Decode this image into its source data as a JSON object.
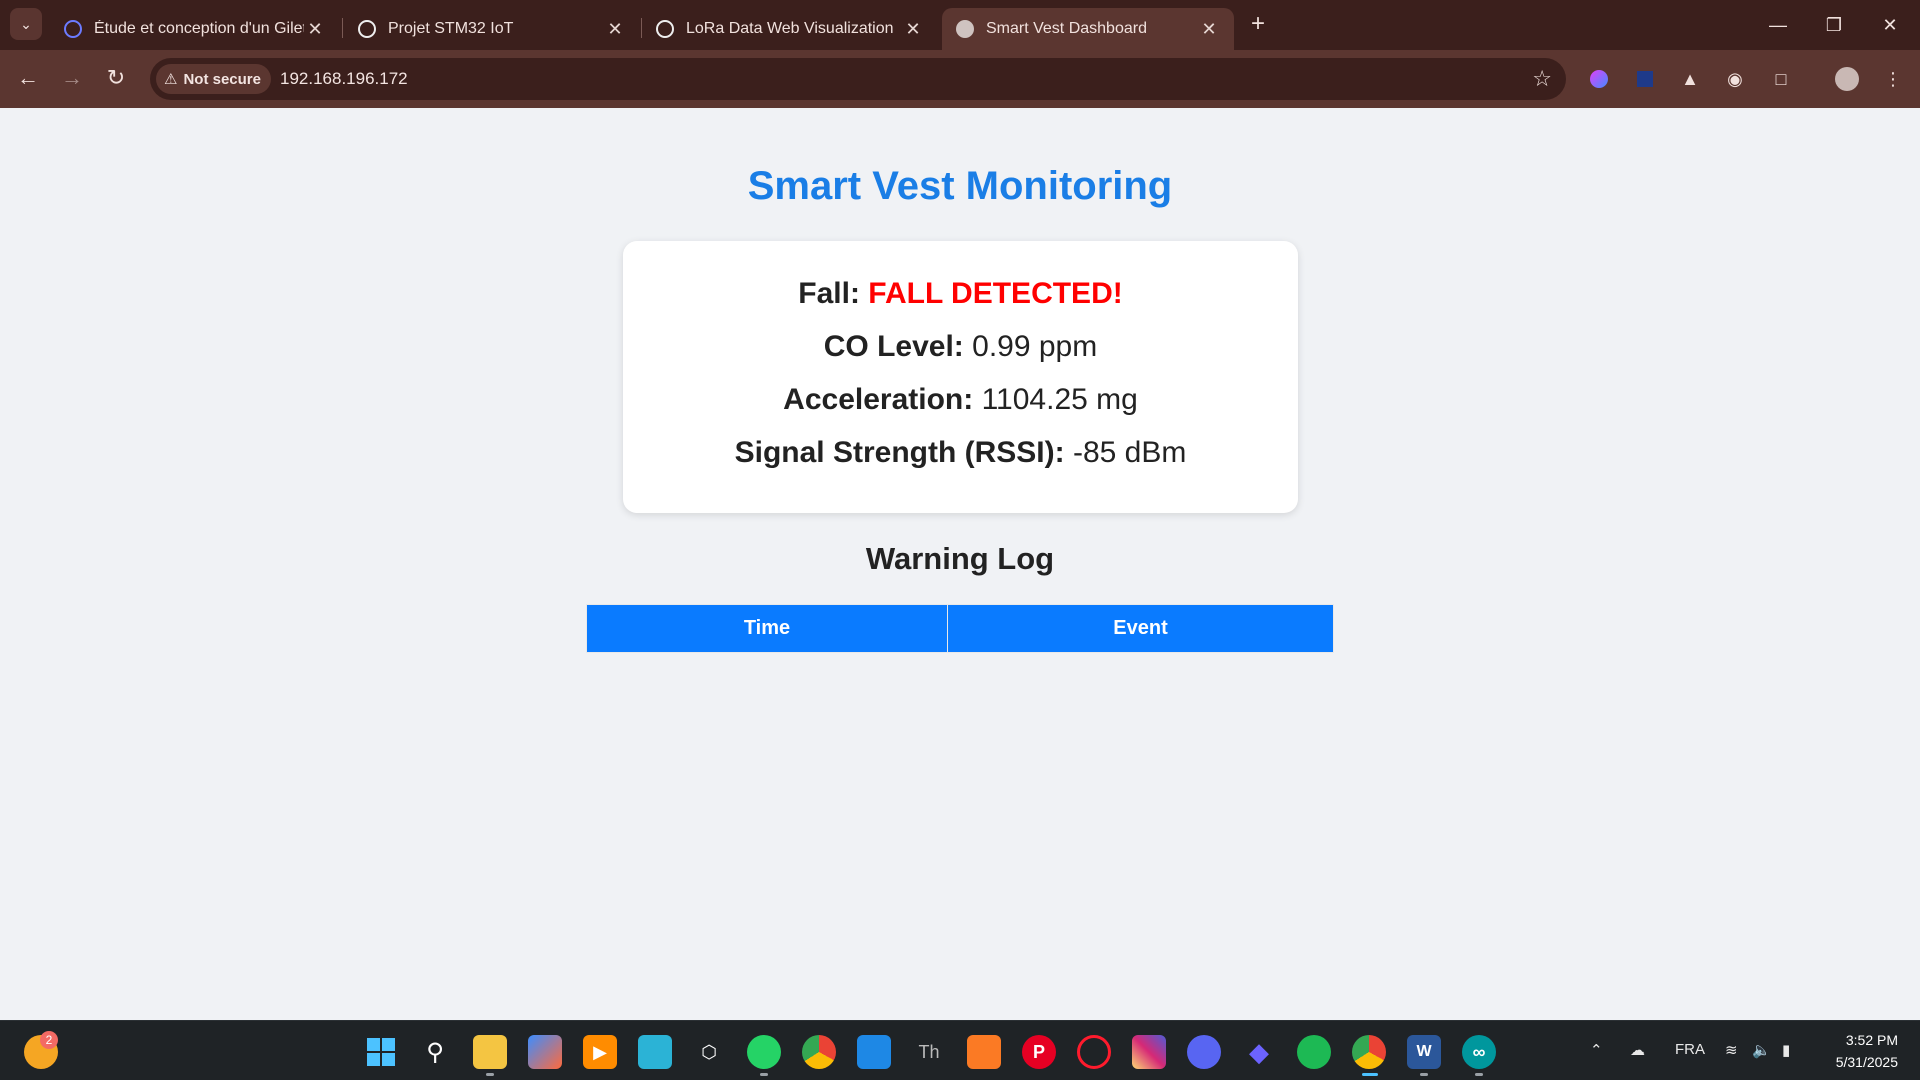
{
  "browser": {
    "tabs": [
      {
        "title": "Étude et conception d'un Gilet I",
        "icon": "orbit-icon"
      },
      {
        "title": "Projet STM32 IoT",
        "icon": "openai-icon"
      },
      {
        "title": "LoRa Data Web Visualization",
        "icon": "openai-icon"
      },
      {
        "title": "Smart Vest Dashboard",
        "icon": "globe-icon",
        "active": true
      }
    ],
    "security_label": "Not secure",
    "url": "192.168.196.172"
  },
  "page": {
    "title": "Smart Vest Monitoring",
    "status": {
      "fall_label": "Fall:",
      "fall_value": "FALL DETECTED!",
      "co_label": "CO Level:",
      "co_value": "0.99 ppm",
      "accel_label": "Acceleration:",
      "accel_value": "1104.25 mg",
      "rssi_label": "Signal Strength (RSSI):",
      "rssi_value": "-85 dBm"
    },
    "log_title": "Warning Log",
    "log_columns": [
      "Time",
      "Event"
    ]
  },
  "taskbar": {
    "notification_count": "2",
    "language": "FRA",
    "time": "3:52 PM",
    "date": "5/31/2025"
  },
  "colors": {
    "title_blue": "#1a7ee6",
    "alert_red": "#ff0000",
    "table_header_blue": "#0a7bff",
    "chrome_dark": "#3b1f1c",
    "chrome_mid": "#5b3630"
  }
}
